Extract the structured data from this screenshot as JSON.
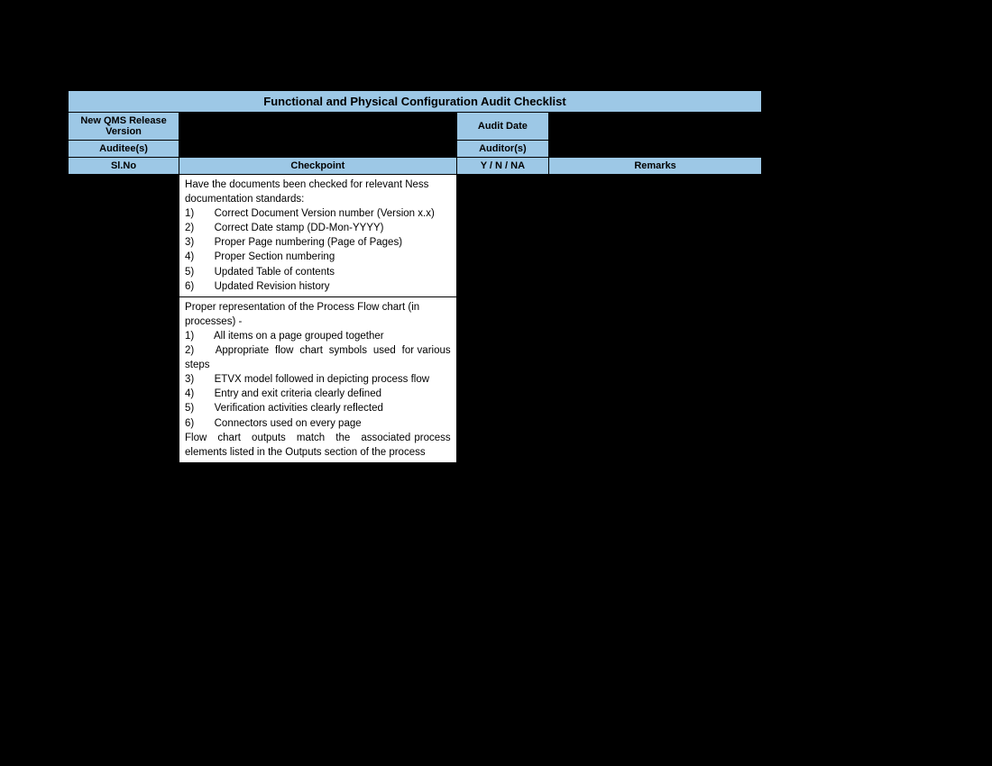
{
  "title": "Functional and Physical Configuration Audit Checklist",
  "meta": {
    "release_label": "New QMS Release Version",
    "release_value": "",
    "audit_date_label": "Audit Date",
    "audit_date_value": "",
    "auditee_label": "Auditee(s)",
    "auditee_value": "",
    "auditor_label": "Auditor(s)",
    "auditor_value": ""
  },
  "columns": {
    "slno": "Sl.No",
    "checkpoint": "Checkpoint",
    "ynna": "Y / N / NA",
    "remarks": "Remarks"
  },
  "rows": [
    {
      "slno": "",
      "lines": [
        "Have the documents been checked for relevant Ness documentation standards:",
        "1)       Correct Document Version number (Version x.x)",
        "2)       Correct Date stamp (DD-Mon-YYYY)",
        "3)       Proper Page numbering (Page of Pages)",
        "4)       Proper Section numbering",
        "5)       Updated Table of contents",
        "6)       Updated Revision history"
      ],
      "ynna": "",
      "remarks": ""
    },
    {
      "slno": "",
      "lines": [
        "Proper representation of the Process Flow chart (in processes) -",
        "1)       All items on a page grouped together",
        "2)       Appropriate  flow  chart  symbols  used  for various steps",
        "3)       ETVX model followed in depicting process flow",
        "4)       Entry and exit criteria clearly defined",
        "5)       Verification activities clearly reflected",
        "6)       Connectors used on every page",
        "Flow   chart   outputs   match   the   associated process elements listed in the Outputs section of the process"
      ],
      "ynna": "",
      "remarks": ""
    }
  ]
}
